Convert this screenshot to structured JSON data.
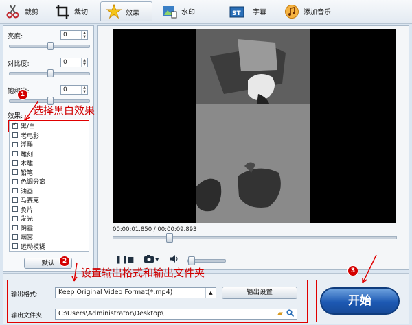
{
  "toolbar": {
    "tabs": [
      {
        "label": "裁剪",
        "icon": "scissors-icon"
      },
      {
        "label": "裁切",
        "icon": "crop-icon"
      },
      {
        "label": "效果",
        "icon": "star-icon"
      },
      {
        "label": "水印",
        "icon": "watermark-icon"
      },
      {
        "label": "字幕",
        "icon": "subtitle-icon"
      },
      {
        "label": "添加音乐",
        "icon": "music-icon"
      }
    ],
    "active_tab": "效果"
  },
  "adjust": {
    "brightness": {
      "label": "亮度:",
      "value": "0"
    },
    "contrast": {
      "label": "对比度:",
      "value": "0"
    },
    "saturation": {
      "label": "饱和度:",
      "value": "0"
    }
  },
  "effects": {
    "label": "效果:",
    "items": [
      {
        "label": "黑/白",
        "checked": true
      },
      {
        "label": "老电影",
        "checked": false
      },
      {
        "label": "浮雕",
        "checked": false
      },
      {
        "label": "雕刻",
        "checked": false
      },
      {
        "label": "木雕",
        "checked": false
      },
      {
        "label": "铅笔",
        "checked": false
      },
      {
        "label": "色调分离",
        "checked": false
      },
      {
        "label": "油画",
        "checked": false
      },
      {
        "label": "马赛克",
        "checked": false
      },
      {
        "label": "负片",
        "checked": false
      },
      {
        "label": "发光",
        "checked": false
      },
      {
        "label": "阴霾",
        "checked": false
      },
      {
        "label": "烟雾",
        "checked": false
      },
      {
        "label": "运动模糊",
        "checked": false
      }
    ],
    "default_button": "默认"
  },
  "player": {
    "time": "00:00:01.850 / 00:00:09.893",
    "progress_fraction": 0.19
  },
  "output": {
    "format_label": "输出格式:",
    "format_value": "Keep Original Video Format(*.mp4)",
    "settings_button": "输出设置",
    "folder_label": "输出文件夹:",
    "folder_value": "C:\\Users\\Administrator\\Desktop\\"
  },
  "start_button": "开始",
  "annotations": {
    "step1": {
      "badge": "1",
      "text": "选择黑白效果"
    },
    "step2": {
      "badge": "2",
      "text": "设置输出格式和输出文件夹"
    },
    "step3": {
      "badge": "3"
    }
  },
  "colors": {
    "annotation": "#e00000",
    "start_button": "#1d59b3"
  }
}
